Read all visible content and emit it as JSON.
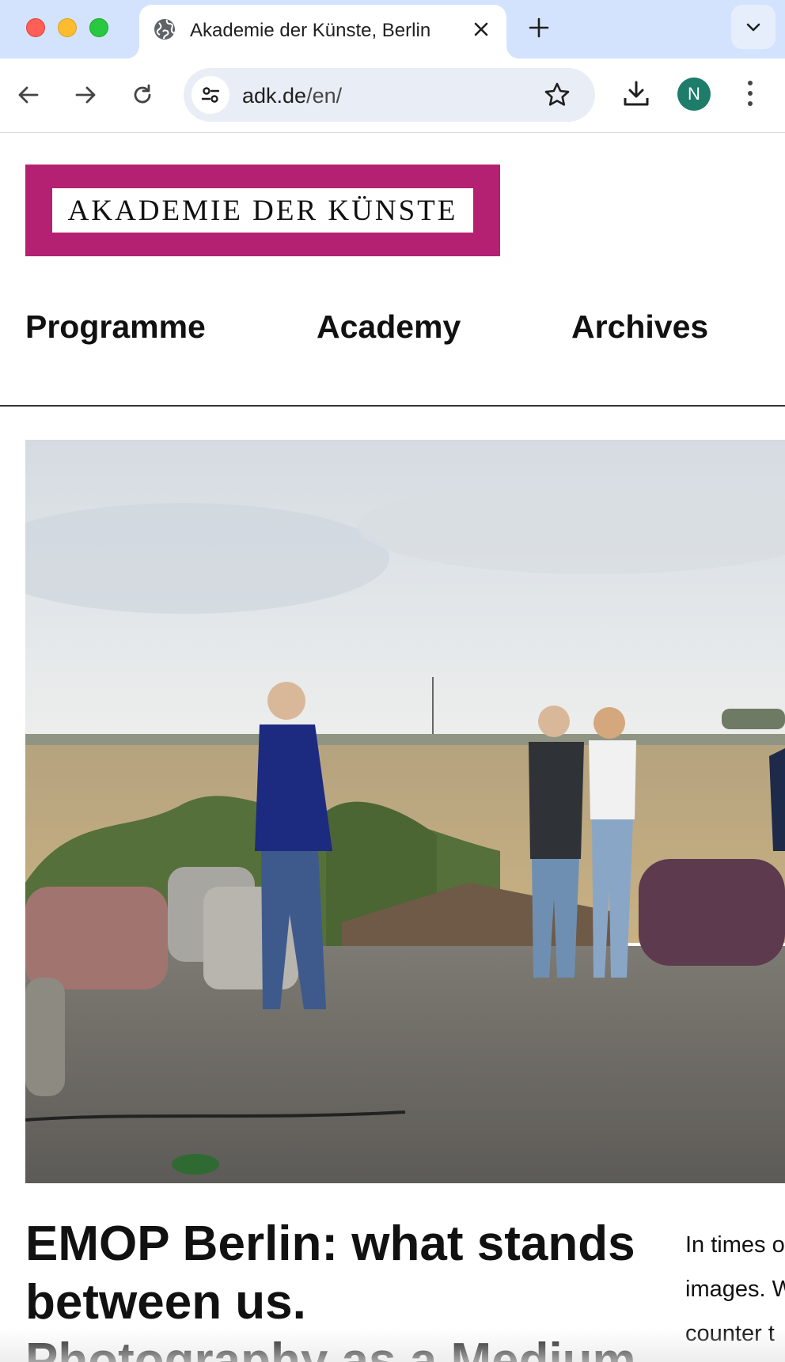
{
  "browser": {
    "tab_title": "Akademie der Künste, Berlin",
    "url_host": "adk.de",
    "url_path": "/en/",
    "profile_initial": "N",
    "icons": {
      "favicon": "globe-icon",
      "close": "close-icon",
      "new_tab": "plus-icon",
      "tab_search": "chevron-down-icon",
      "back": "arrow-left-icon",
      "forward": "arrow-right-icon",
      "reload": "reload-icon",
      "site_info": "tune-icon",
      "bookmark": "star-icon",
      "download": "download-icon",
      "menu": "kebab-menu-icon"
    },
    "colors": {
      "tabbar": "#d3e3fd",
      "omnibox": "#e9eef6",
      "avatar": "#1e7c6a"
    }
  },
  "site": {
    "logo_text": "AKADEMIE DER KÜNSTE",
    "logo_color": "#b52172",
    "nav": [
      "Programme",
      "Academy",
      "Archives"
    ]
  },
  "hero": {
    "image_alt": "Young people standing in a field next to discarded armchairs under a cloudy sky"
  },
  "article": {
    "headline_lines": [
      "EMOP Berlin: what stands",
      "between us.",
      "Photography as a Medium"
    ],
    "teaser_lines": [
      "In times o",
      "images. W",
      "counter t"
    ]
  }
}
